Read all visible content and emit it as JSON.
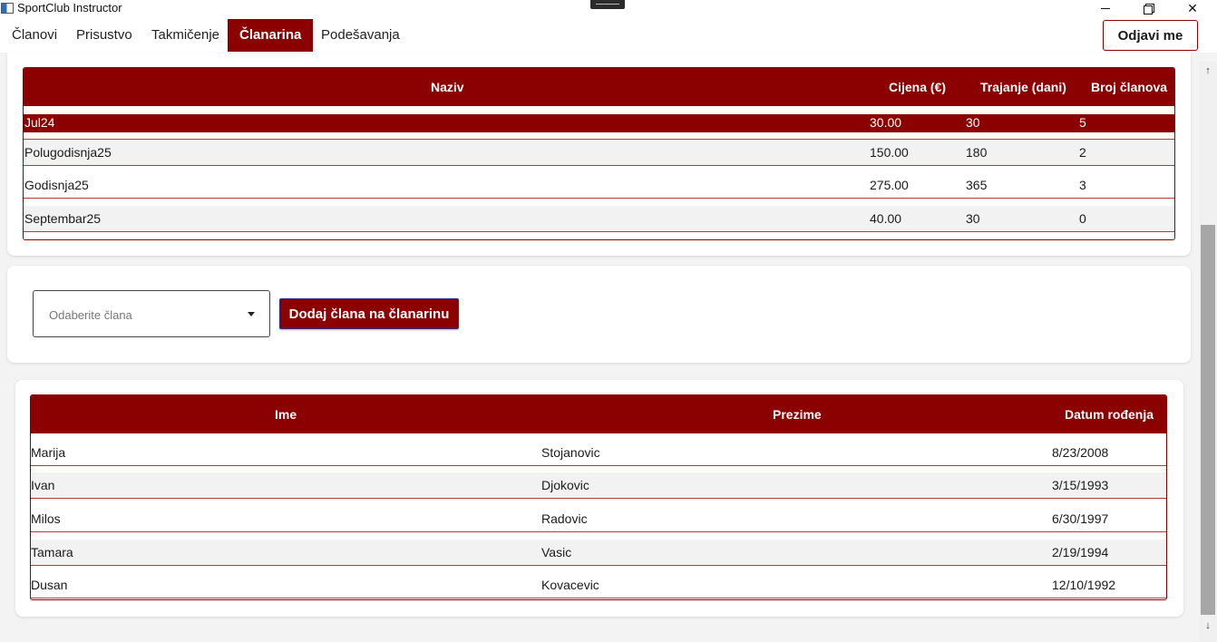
{
  "window": {
    "title": "SportClub Instructor",
    "icons": {
      "minimize": "minimize-icon",
      "maximize": "restore-icon",
      "close": "close-icon"
    },
    "close_glyph": "✕"
  },
  "nav": {
    "tabs": [
      {
        "label": "Članovi"
      },
      {
        "label": "Prisustvo"
      },
      {
        "label": "Takmičenje"
      },
      {
        "label": "Članarina",
        "active": true
      },
      {
        "label": "Podešavanja"
      }
    ],
    "logout_label": "Odjavi me"
  },
  "memberships": {
    "headers": {
      "naziv": "Naziv",
      "cijena": "Cijena (€)",
      "trajanje": "Trajanje (dani)",
      "broj": "Broj članova"
    },
    "rows": [
      {
        "naziv": "Jul24",
        "cijena": "30.00",
        "trajanje": "30",
        "broj": "5",
        "selected": true
      },
      {
        "naziv": "Polugodisnja25",
        "cijena": "150.00",
        "trajanje": "180",
        "broj": "2"
      },
      {
        "naziv": "Godisnja25",
        "cijena": "275.00",
        "trajanje": "365",
        "broj": "3"
      },
      {
        "naziv": "Septembar25",
        "cijena": "40.00",
        "trajanje": "30",
        "broj": "0"
      }
    ]
  },
  "form": {
    "member_select_placeholder": "Odaberite člana",
    "add_button_label": "Dodaj člana na članarinu"
  },
  "members": {
    "headers": {
      "ime": "Ime",
      "prezime": "Prezime",
      "datum": "Datum rođenja"
    },
    "rows": [
      {
        "ime": "Marija",
        "prezime": "Stojanovic",
        "datum": "8/23/2008"
      },
      {
        "ime": "Ivan",
        "prezime": "Djokovic",
        "datum": "3/15/1993"
      },
      {
        "ime": "Milos",
        "prezime": "Radovic",
        "datum": "6/30/1997"
      },
      {
        "ime": "Tamara",
        "prezime": "Vasic",
        "datum": "2/19/1994"
      },
      {
        "ime": "Dusan",
        "prezime": "Kovacevic",
        "datum": "12/10/1992"
      }
    ]
  },
  "scrollbar": {
    "up_glyph": "↑",
    "down_glyph": "↓"
  },
  "colors": {
    "accent": "#8b0000",
    "row_alt": "#f2f2f2",
    "background": "#f3f3f3"
  }
}
